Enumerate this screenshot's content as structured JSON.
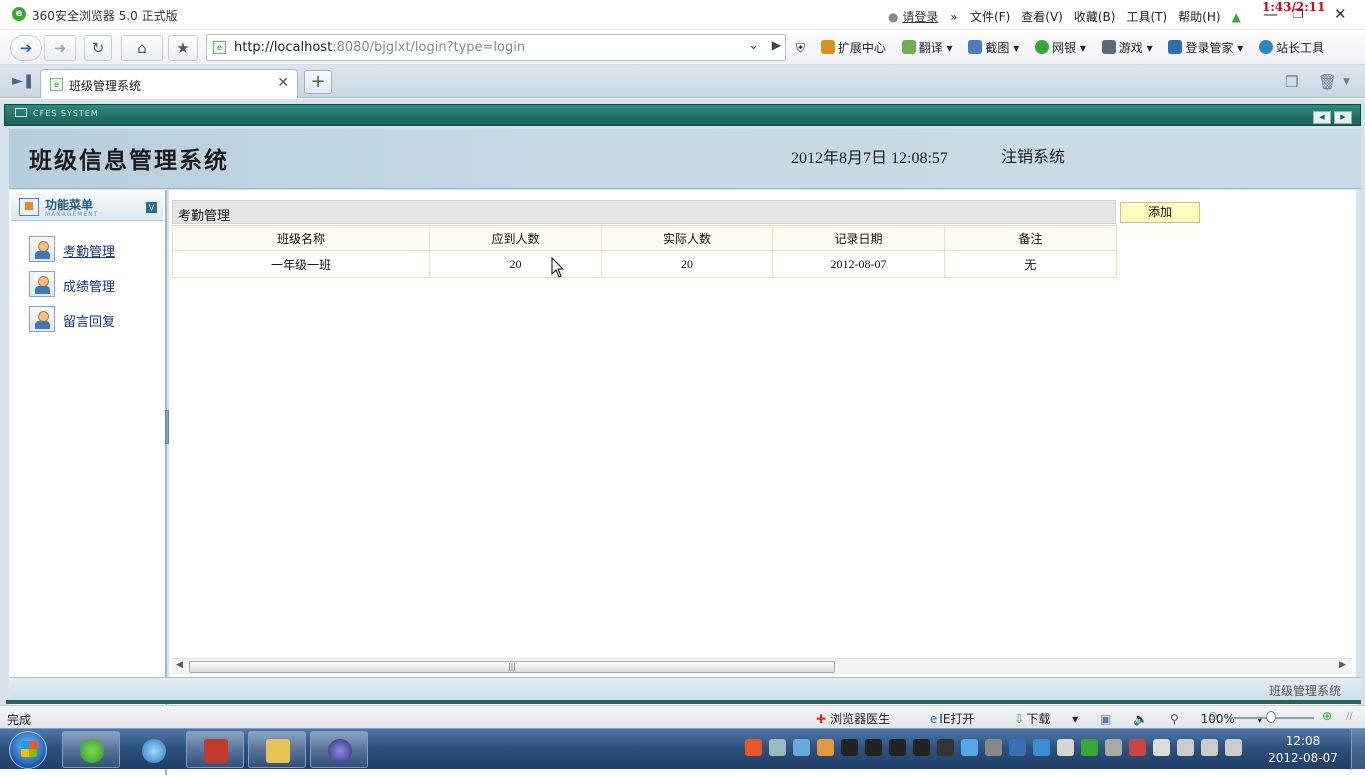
{
  "browser": {
    "app_title": "360安全浏览器 5.0 正式版",
    "login_prefix": "",
    "login_label": "请登录",
    "menus": [
      "文件(F)",
      "查看(V)",
      "收藏(B)",
      "工具(T)",
      "帮助(H)"
    ],
    "overlay_clock": "1:43/2:11",
    "url_host": "http://localhost",
    "url_rest": ":8080/bjglxt/login?type=login",
    "tools": [
      "扩展中心",
      "翻译",
      "截图",
      "网银",
      "游戏",
      "登录管家",
      "站长工具"
    ],
    "tab_title": "班级管理系统",
    "status_text": "完成",
    "status_items": {
      "doctor": "浏览器医生",
      "ie_open": "IE打开",
      "download": "下载",
      "zoom": "100%"
    },
    "taskbar_time": "12:08",
    "taskbar_date": "2012-08-07"
  },
  "app": {
    "system_label": "CFES SYSTEM",
    "system_name": "班级信息管理系统",
    "datetime": "2012年8月7日  12:08:57",
    "logout": "注销系统",
    "menu_title": "功能菜单",
    "menu_subtitle": "MANAGEMENT",
    "menu_items": [
      {
        "label": "考勤管理"
      },
      {
        "label": "成绩管理"
      },
      {
        "label": "留言回复"
      }
    ],
    "panel_title": "考勤管理",
    "add_label": "添加",
    "columns": [
      "班级名称",
      "应到人数",
      "实际人数",
      "记录日期",
      "备注"
    ],
    "rows": [
      [
        "一年级一班",
        "20",
        "20",
        "2012-08-07",
        "无"
      ]
    ],
    "footer": "班级管理系统"
  },
  "colors": {
    "header_teal": "#1b5e58",
    "banner_blue": "#c6dae6",
    "add_button": "#fdfcbe",
    "clock_red": "#d0021b",
    "taskbar_blue": "#2c4f7c"
  }
}
